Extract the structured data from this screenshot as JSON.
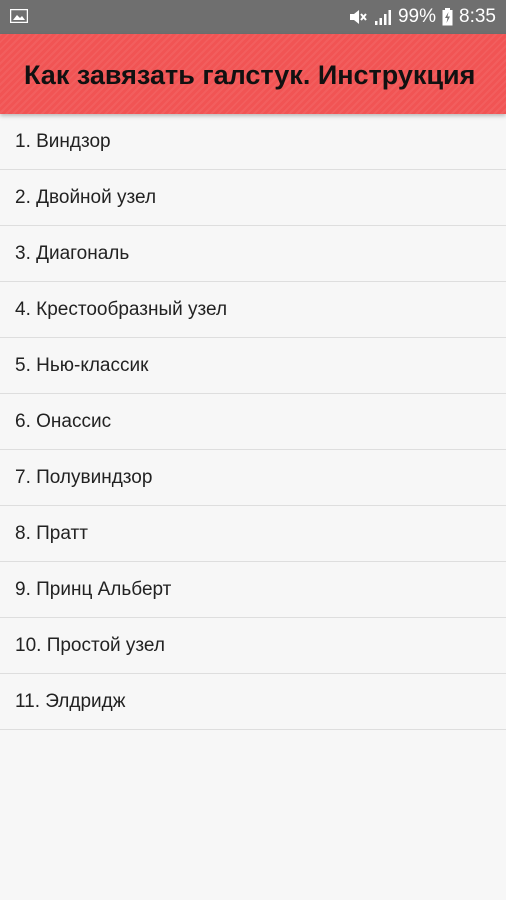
{
  "status_bar": {
    "battery_percent": "99%",
    "time": "8:35",
    "icons": [
      "gallery-icon",
      "mute-icon",
      "signal-icon",
      "battery-charging-icon"
    ]
  },
  "app_bar": {
    "title": "Как завязать галстук. Инструкция",
    "background_color": "#f15454"
  },
  "list": {
    "items": [
      {
        "label": "1. Виндзор"
      },
      {
        "label": "2. Двойной узел"
      },
      {
        "label": "3. Диагональ"
      },
      {
        "label": "4. Крестообразный узел"
      },
      {
        "label": "5. Нью-классик"
      },
      {
        "label": "6. Онассис"
      },
      {
        "label": "7. Полувиндзор"
      },
      {
        "label": "8. Пратт"
      },
      {
        "label": "9. Принц Альберт"
      },
      {
        "label": "10. Простой узел"
      },
      {
        "label": "11. Элдридж"
      }
    ]
  }
}
